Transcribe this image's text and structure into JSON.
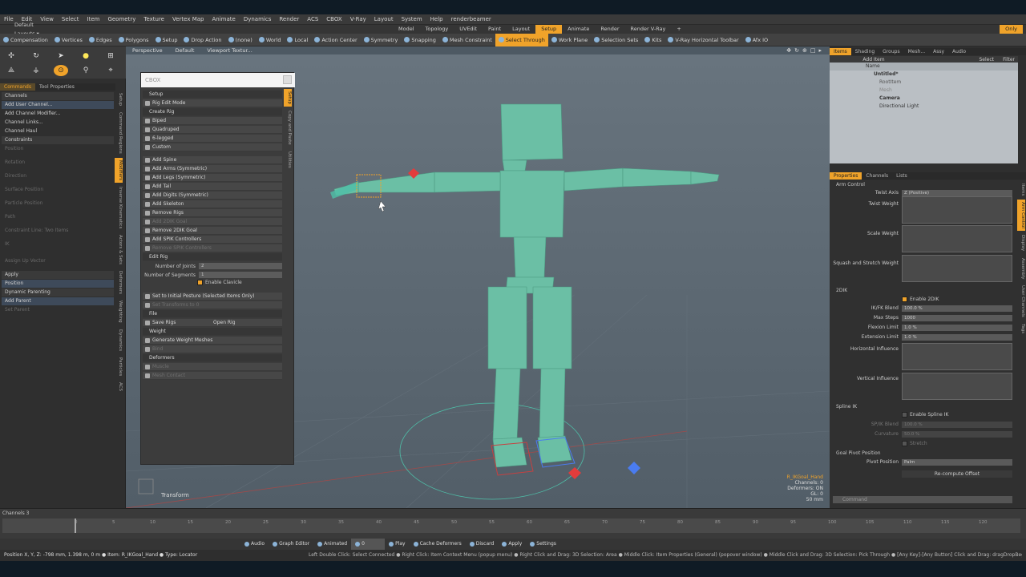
{
  "menubar": [
    "File",
    "Edit",
    "View",
    "Select",
    "Item",
    "Geometry",
    "Texture",
    "Vertex Map",
    "Animate",
    "Dynamics",
    "Render",
    "ACS",
    "CBOX",
    "V-Ray",
    "Layout",
    "System",
    "Help",
    "renderbeamer"
  ],
  "layout": {
    "default_layouts": "Default Layouts ▾",
    "tabs": [
      "Model",
      "Topology",
      "UVEdit",
      "Paint",
      "Layout",
      "Setup",
      "Animate",
      "Render",
      "Render V-Ray"
    ],
    "active_tab": "Setup",
    "add_tab": "+",
    "only": "Only"
  },
  "toolbar": {
    "items": [
      "Compensation",
      "Vertices",
      "Edges",
      "Polygons",
      "Setup",
      "Drop Action",
      "(none)",
      "World",
      "Local",
      "Action Center",
      "Symmetry",
      "Snapping",
      "Mesh Constraint",
      "Select Through",
      "Work Plane",
      "Selection Sets",
      "Kits",
      "V-Ray Horizontal Toolbar",
      "Afx IO"
    ],
    "highlighted": "Select Through"
  },
  "left_panel": {
    "tabs": [
      "Commands",
      "Tool Properties"
    ],
    "items": [
      {
        "label": "Channels",
        "kind": "sec"
      },
      {
        "label": "Add User Channel...",
        "kind": "blue"
      },
      {
        "label": "Add Channel Modifier...",
        "kind": ""
      },
      {
        "label": "Channel Links...",
        "kind": ""
      },
      {
        "label": "Channel Haul",
        "kind": ""
      },
      {
        "label": "Constraints",
        "kind": "sec"
      },
      {
        "label": "Position",
        "kind": "dim"
      },
      {
        "label": "Rotation",
        "kind": "dim"
      },
      {
        "label": "Direction",
        "kind": "dim"
      },
      {
        "label": "Surface Position",
        "kind": "dim"
      },
      {
        "label": "Particle Position",
        "kind": "dim"
      },
      {
        "label": "Path",
        "kind": "dim"
      },
      {
        "label": "Constraint Line: Two Items",
        "kind": "dim"
      },
      {
        "label": "IK",
        "kind": "dim"
      },
      {
        "label": "Assign Up Vector",
        "kind": "dim"
      },
      {
        "label": "Apply",
        "kind": "sec"
      },
      {
        "label": "Position",
        "kind": "blue"
      },
      {
        "label": "Dynamic Parenting",
        "kind": "sec"
      },
      {
        "label": "Add Parent",
        "kind": "blue"
      },
      {
        "label": "Set Parent",
        "kind": "dim"
      }
    ],
    "vtabs": [
      "Setup",
      "Command Regions",
      "Modifiers",
      "Inverse Kinematics",
      "Actors & Sets",
      "Deformers",
      "Weighting",
      "Dynamics",
      "Particles",
      "ACS"
    ],
    "active_vtab": "Modifiers"
  },
  "viewport": {
    "header": [
      "Perspective",
      "Default",
      "Viewport Textur..."
    ],
    "status": [
      "R_IKGoal_Hand",
      "Channels: 0",
      "Deformers: ON",
      "GL: 0",
      "50 mm"
    ],
    "transform_label": "Transform"
  },
  "cbox": {
    "title": "CBOX",
    "items": [
      {
        "label": "Setup",
        "kind": "hdr"
      },
      {
        "label": "Rig Edit Mode",
        "kind": ""
      },
      {
        "label": "Create Rig",
        "kind": "hdr"
      },
      {
        "label": "Biped",
        "kind": ""
      },
      {
        "label": "Quadruped",
        "kind": ""
      },
      {
        "label": "6-legged",
        "kind": ""
      },
      {
        "label": "Custom",
        "kind": ""
      },
      {
        "label": "",
        "kind": "gap"
      },
      {
        "label": "Add Spine",
        "kind": ""
      },
      {
        "label": "Add Arms (Symmetric)",
        "kind": ""
      },
      {
        "label": "Add Legs (Symmetric)",
        "kind": ""
      },
      {
        "label": "Add Tail",
        "kind": ""
      },
      {
        "label": "Add Digits (Symmetric)",
        "kind": ""
      },
      {
        "label": "Add Skeleton",
        "kind": ""
      },
      {
        "label": "Remove Rigs",
        "kind": ""
      },
      {
        "label": "Add 2DIK Goal",
        "kind": "dim"
      },
      {
        "label": "Remove 2DIK Goal",
        "kind": ""
      },
      {
        "label": "Add SPIK Controllers",
        "kind": ""
      },
      {
        "label": "Remove SPIK Controllers",
        "kind": "dim"
      },
      {
        "label": "Edit Rig",
        "kind": "hdr"
      }
    ],
    "num_joints_label": "Number of Joints",
    "num_joints": "2",
    "num_segments_label": "Number of Segments",
    "num_segments": "1",
    "enable_clavicle": "Enable Clavicle",
    "items2": [
      {
        "label": "Set to Initial Posture (Selected Items Only)",
        "kind": ""
      },
      {
        "label": "Set Transforms to 0",
        "kind": "dim"
      },
      {
        "label": "File",
        "kind": "hdr"
      },
      {
        "label": "Save Rigs",
        "kind": "split",
        "right": "Open Rig"
      },
      {
        "label": "Weight",
        "kind": "hdr"
      },
      {
        "label": "Generate Weight Meshes",
        "kind": ""
      },
      {
        "label": "Bind",
        "kind": "dim"
      },
      {
        "label": "Deformers",
        "kind": "hdr"
      },
      {
        "label": "Muscle",
        "kind": "dim"
      },
      {
        "label": "Mesh Contact",
        "kind": "dim"
      }
    ],
    "vtabs": [
      "Setup",
      "Copy and Paste",
      "Utilities"
    ]
  },
  "right_panel": {
    "tabs": [
      "Items",
      "Shading",
      "Groups",
      "Mesh...",
      "Assy",
      "Audio"
    ],
    "add_item": "Add Item",
    "select": "Select",
    "filter": "Filter",
    "name_header": "Name",
    "tree": [
      "Untitled*",
      "RootItem",
      "Mesh",
      "Camera",
      "Directional Light"
    ],
    "prop_tabs": [
      "Properties",
      "Channels",
      "Lists"
    ],
    "arm_control": "Arm Control",
    "twist_axis_label": "Twist Axis",
    "twist_axis": "Z (Positive)",
    "twist_weight": "Twist Weight",
    "scale_weight": "Scale Weight",
    "squash_weight": "Squash and Stretch Weight",
    "ik2d": "2DIK",
    "enable_2dik": "Enable 2DIK",
    "ikfk_label": "IK/FK Blend",
    "ikfk": "100.0 %",
    "maxsteps_label": "Max Steps",
    "maxsteps": "1000",
    "flexion_label": "Flexion Limit",
    "flexion": "1.0 %",
    "extension_label": "Extension Limit",
    "extension": "1.0 %",
    "horiz_influence": "Horizontal Influence",
    "vert_influence": "Vertical Influence",
    "spline_ik": "Spline IK",
    "enable_spline": "Enable Spline IK",
    "spik_label": "SP/IK Blend",
    "spik": "100.0 %",
    "curv_label": "Curvature",
    "curv": "50.0 %",
    "stretch": "Stretch",
    "goal_pivot": "Goal Pivot Position",
    "pivot_label": "Pivot Position",
    "pivot": "Palm",
    "recompute": "Re-compute Offset",
    "command_placeholder": "Command",
    "vtabs": [
      "Items",
      "Arm Control",
      "Display",
      "Assembly",
      "User Channels",
      "Tags"
    ]
  },
  "timeline": {
    "channels": "Channels 3",
    "ticks": [
      "0",
      "5",
      "10",
      "15",
      "20",
      "25",
      "30",
      "35",
      "40",
      "45",
      "50",
      "55",
      "60",
      "65",
      "70",
      "75",
      "80",
      "85",
      "90",
      "95",
      "100",
      "105",
      "110",
      "115",
      "120"
    ]
  },
  "transport": {
    "items": [
      "Audio",
      "Graph Editor",
      "Animated",
      "0",
      "Play",
      "Cache Deformers",
      "Discard",
      "Apply",
      "Settings"
    ]
  },
  "info": "Position X, Y, Z:  -798 mm, 1.398 m, 0 m  ● Item:  R_IKGoal_Hand  ● Type:  Locator",
  "hints": "Left Double Click: Select Connected ● Right Click: Item Context Menu (popup menu) ● Right Click and Drag: 3D Selection: Area ● Middle Click: Item Properties (General) (popover window) ● Middle Click and Drag: 3D Selection: Pick Through ● [Any Key]-[Any Button] Click and Drag: dragDropBegin"
}
